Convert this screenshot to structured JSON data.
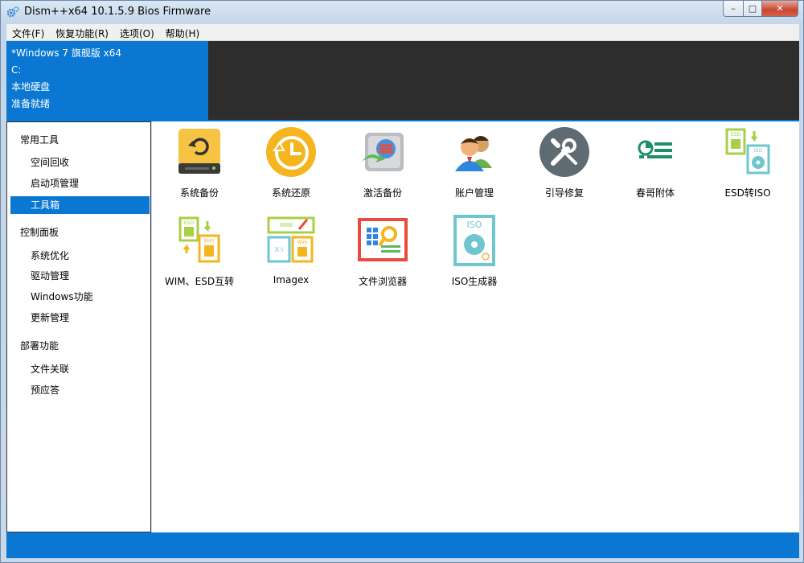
{
  "window": {
    "title": "Dism++x64 10.1.5.9 Bios Firmware",
    "controls": {
      "minimize": "–",
      "maximize": "□",
      "close": "✕"
    }
  },
  "menu": [
    "文件(F)",
    "恢复功能(R)",
    "选项(O)",
    "帮助(H)"
  ],
  "info": {
    "os": "*Windows 7 旗舰版 x64",
    "drive": "C:",
    "disk": "本地硬盘",
    "status": "准备就绪"
  },
  "sidebar": {
    "sections": [
      {
        "title": "常用工具",
        "items": [
          "空间回收",
          "启动项管理",
          "工具箱"
        ]
      },
      {
        "title": "控制面板",
        "items": [
          "系统优化",
          "驱动管理",
          "Windows功能",
          "更新管理"
        ]
      },
      {
        "title": "部署功能",
        "items": [
          "文件关联",
          "预应答"
        ]
      }
    ],
    "selected": "工具箱"
  },
  "tools": [
    {
      "label": "系统备份",
      "icon": "backup-drive-icon"
    },
    {
      "label": "系统还原",
      "icon": "restore-clock-icon"
    },
    {
      "label": "激活备份",
      "icon": "activation-backup-icon"
    },
    {
      "label": "账户管理",
      "icon": "users-icon"
    },
    {
      "label": "引导修复",
      "icon": "wrench-screwdriver-icon"
    },
    {
      "label": "春哥附体",
      "icon": "toggle-list-icon"
    },
    {
      "label": "ESD转ISO",
      "icon": "esd-to-iso-icon"
    },
    {
      "label": "WIM、ESD互转",
      "icon": "wim-esd-convert-icon"
    },
    {
      "label": "Imagex",
      "icon": "imagex-icon"
    },
    {
      "label": "文件浏览器",
      "icon": "file-browser-icon"
    },
    {
      "label": "ISO生成器",
      "icon": "iso-generator-icon"
    }
  ],
  "icon_texts": {
    "esd": "ESD",
    "iso": "ISO",
    "wim": "Wim",
    "drive": "X:\\"
  },
  "colors": {
    "accent": "#0a78d2",
    "dark_panel": "#2d2d2d",
    "restore_yellow": "#f4b51f",
    "tool_gray": "#5f6b73",
    "iso_teal": "#6fc6cf",
    "esd_green": "#a8cf45"
  }
}
